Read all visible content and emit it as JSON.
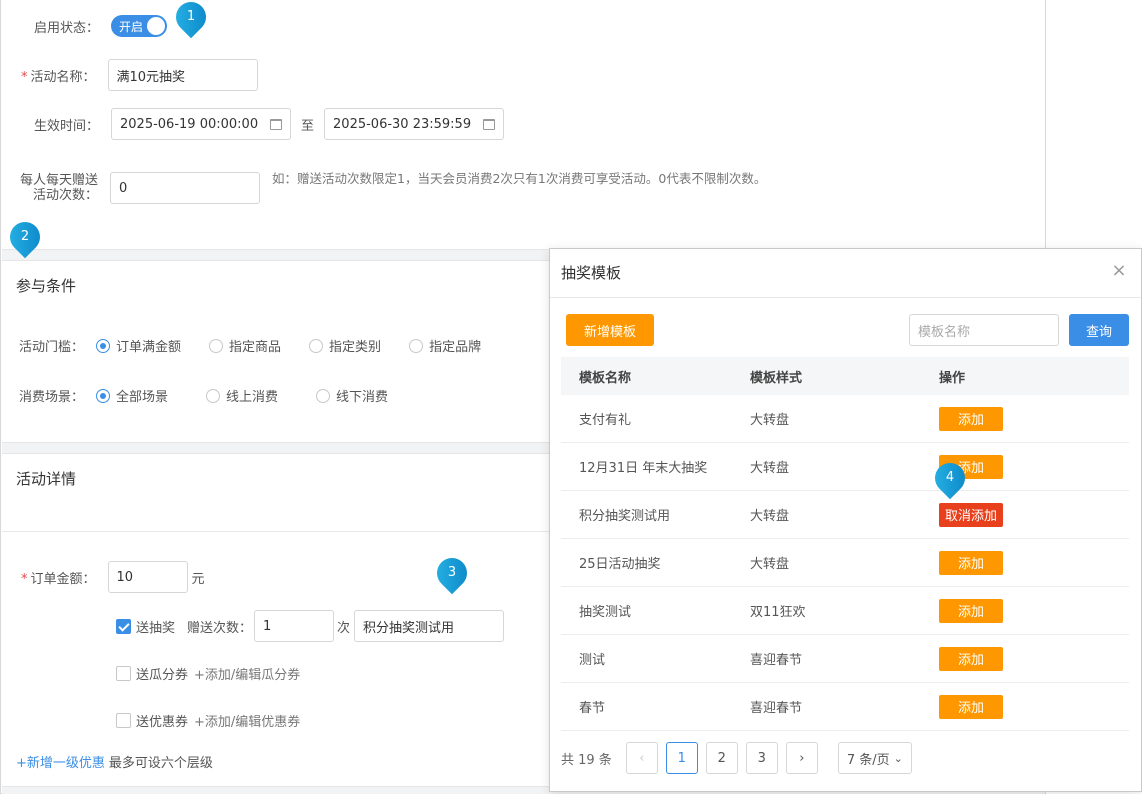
{
  "form": {
    "status_label": "启用状态：",
    "status_toggle": "开启",
    "name_label": "活动名称：",
    "name_value": "满10元抽奖",
    "time_label": "生效时间：",
    "time_start": "2025-06-19 00:00:00",
    "time_sep": "至",
    "time_end": "2025-06-30 23:59:59",
    "limit_label_1": "每人每天赠送",
    "limit_label_2": "活动次数：",
    "limit_value": "0",
    "limit_hint": "如：赠送活动次数限定1，当天会员消费2次只有1次消费可享受活动。0代表不限制次数。"
  },
  "conditions": {
    "title": "参与条件",
    "threshold_label": "活动门槛：",
    "threshold_options": [
      "订单满金额",
      "指定商品",
      "指定类别",
      "指定品牌"
    ],
    "scene_label": "消费场景：",
    "scene_options": [
      "全部场景",
      "线上消费",
      "线下消费"
    ]
  },
  "details": {
    "title": "活动详情",
    "amount_label": "订单金额：",
    "amount_value": "10",
    "amount_unit": "元",
    "lottery_label": "送抽奖",
    "gift_count_label": "赠送次数：",
    "gift_count_value": "1",
    "gift_count_unit": "次",
    "lottery_template": "积分抽奖测试用",
    "melon_label": "送瓜分券",
    "melon_link": "+添加/编辑瓜分券",
    "coupon_label": "送优惠券",
    "coupon_link": "+添加/编辑优惠券",
    "add_level_link": "+新增一级优惠",
    "add_level_note": "最多可设六个层级"
  },
  "markers": [
    "1",
    "2",
    "3",
    "4"
  ],
  "modal": {
    "title": "抽奖模板",
    "close_icon": "×",
    "new_button": "新增模板",
    "search_placeholder": "模板名称",
    "query_button": "查询",
    "columns": [
      "模板名称",
      "模板样式",
      "操作"
    ],
    "rows": [
      {
        "name": "支付有礼",
        "style": "大转盘",
        "action": "添加"
      },
      {
        "name": "12月31日 年末大抽奖",
        "style": "大转盘",
        "action": "添加"
      },
      {
        "name": "积分抽奖测试用",
        "style": "大转盘",
        "action": "取消添加"
      },
      {
        "name": "25日活动抽奖",
        "style": "大转盘",
        "action": "添加"
      },
      {
        "name": "抽奖测试",
        "style": "双11狂欢",
        "action": "添加"
      },
      {
        "name": "测试",
        "style": "喜迎春节",
        "action": "添加"
      },
      {
        "name": "春节",
        "style": "喜迎春节",
        "action": "添加"
      }
    ],
    "pager": {
      "total": "共 19 条",
      "prev": "‹",
      "pages": [
        "1",
        "2",
        "3"
      ],
      "next": "›",
      "page_size": "7 条/页",
      "page_size_icon": "⌄"
    }
  },
  "colors": {
    "primary": "#3a8ee6",
    "orange": "#ff9800",
    "danger": "#e8401c"
  }
}
